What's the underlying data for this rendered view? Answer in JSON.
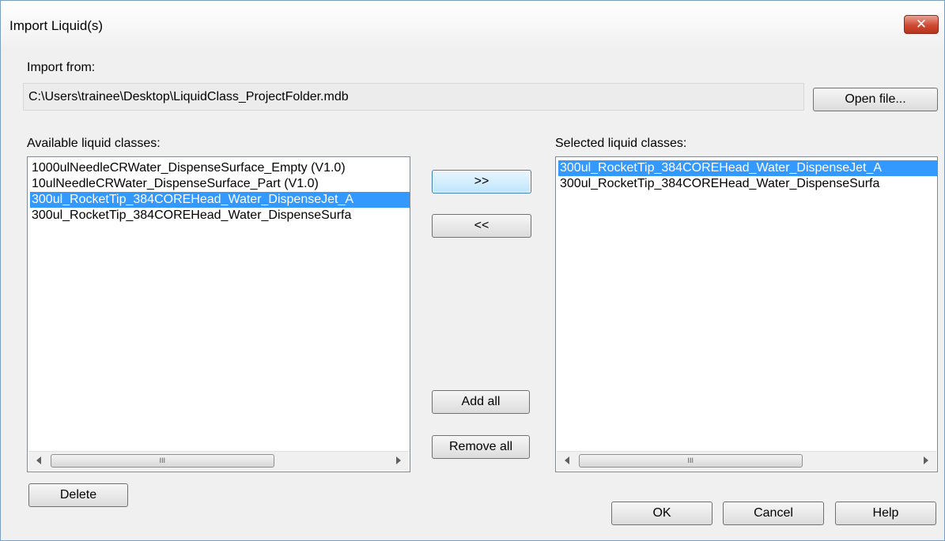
{
  "window": {
    "title": "Import Liquid(s)",
    "close_glyph": "✕"
  },
  "import_from": {
    "label": "Import from:",
    "path": "C:\\Users\\trainee\\Desktop\\LiquidClass_ProjectFolder.mdb",
    "open_label": "Open file..."
  },
  "available": {
    "label": "Available liquid classes:",
    "items": [
      {
        "text": "1000ulNeedleCRWater_DispenseSurface_Empty (V1.0)",
        "selected": false
      },
      {
        "text": "10ulNeedleCRWater_DispenseSurface_Part (V1.0)",
        "selected": false
      },
      {
        "text": "300ul_RocketTip_384COREHead_Water_DispenseJet_A",
        "selected": true
      },
      {
        "text": "300ul_RocketTip_384COREHead_Water_DispenseSurfa",
        "selected": false
      }
    ]
  },
  "selected": {
    "label": "Selected liquid classes:",
    "items": [
      {
        "text": "300ul_RocketTip_384COREHead_Water_DispenseJet_A",
        "selected": true
      },
      {
        "text": "300ul_RocketTip_384COREHead_Water_DispenseSurfa",
        "selected": false
      }
    ]
  },
  "buttons": {
    "add": ">>",
    "remove": "<<",
    "add_all": "Add all",
    "remove_all": "Remove all",
    "delete": "Delete",
    "ok": "OK",
    "cancel": "Cancel",
    "help": "Help"
  },
  "scroll": {
    "grip": "III"
  },
  "colors": {
    "selection": "#3399ff",
    "close": "#cf4a33"
  }
}
